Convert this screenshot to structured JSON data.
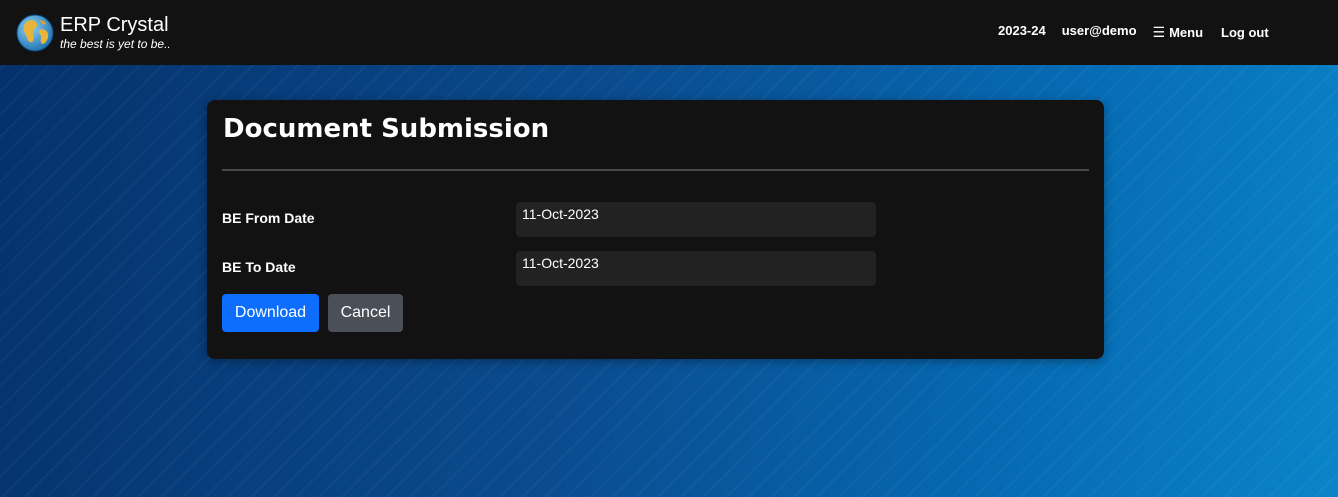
{
  "header": {
    "app_title": "ERP Crystal",
    "tagline": "the best is yet to be..",
    "logo_icon": "globe-icon",
    "year": "2023-24",
    "user": "user@demo",
    "menu_icon": "hamburger-icon",
    "menu_label": "Menu",
    "logout_label": "Log out"
  },
  "form": {
    "title": "Document Submission",
    "fields": [
      {
        "label": "BE From Date",
        "value": "11-Oct-2023"
      },
      {
        "label": "BE To Date",
        "value": "11-Oct-2023"
      }
    ],
    "download_label": "Download",
    "cancel_label": "Cancel"
  },
  "colors": {
    "topbar": "#121212",
    "card": "#121212",
    "input_bg": "#222222",
    "primary": "#0d6efd",
    "secondary": "#4b5058"
  }
}
